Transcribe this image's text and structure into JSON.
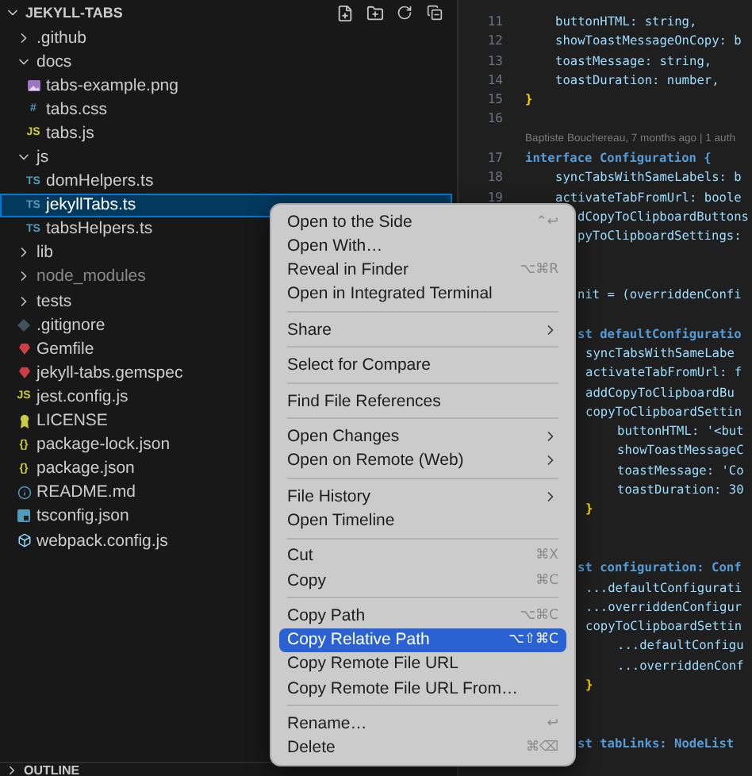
{
  "explorer": {
    "title": "JEKYLL-TABS",
    "expanded": true,
    "tree": [
      {
        "name": ".github",
        "kind": "folder",
        "expanded": false,
        "selected": false,
        "dimmed": false
      },
      {
        "name": "docs",
        "kind": "folder",
        "expanded": true,
        "selected": false,
        "dimmed": false,
        "children": [
          {
            "name": "tabs-example.png",
            "kind": "image",
            "selected": false,
            "dimmed": false
          },
          {
            "name": "tabs.css",
            "kind": "css",
            "glyph": "#",
            "selected": false,
            "dimmed": false
          },
          {
            "name": "tabs.js",
            "kind": "js",
            "glyph": "JS",
            "selected": false,
            "dimmed": false
          }
        ]
      },
      {
        "name": "js",
        "kind": "folder",
        "expanded": true,
        "selected": false,
        "dimmed": false,
        "children": [
          {
            "name": "domHelpers.ts",
            "kind": "ts",
            "glyph": "TS",
            "selected": false,
            "dimmed": false
          },
          {
            "name": "jekyllTabs.ts",
            "kind": "ts",
            "glyph": "TS",
            "selected": true,
            "dimmed": false
          },
          {
            "name": "tabsHelpers.ts",
            "kind": "ts",
            "glyph": "TS",
            "selected": false,
            "dimmed": false
          }
        ]
      },
      {
        "name": "lib",
        "kind": "folder",
        "expanded": false,
        "selected": false,
        "dimmed": false
      },
      {
        "name": "node_modules",
        "kind": "folder",
        "expanded": false,
        "selected": false,
        "dimmed": true
      },
      {
        "name": "tests",
        "kind": "folder",
        "expanded": false,
        "selected": false,
        "dimmed": false
      },
      {
        "name": ".gitignore",
        "kind": "ignore",
        "selected": false,
        "dimmed": false
      },
      {
        "name": "Gemfile",
        "kind": "gem",
        "selected": false,
        "dimmed": false
      },
      {
        "name": "jekyll-tabs.gemspec",
        "kind": "gem",
        "selected": false,
        "dimmed": false
      },
      {
        "name": "jest.config.js",
        "kind": "js",
        "glyph": "JS",
        "selected": false,
        "dimmed": false
      },
      {
        "name": "LICENSE",
        "kind": "license",
        "selected": false,
        "dimmed": false
      },
      {
        "name": "package-lock.json",
        "kind": "json",
        "glyph": "{}",
        "selected": false,
        "dimmed": false
      },
      {
        "name": "package.json",
        "kind": "json",
        "glyph": "{}",
        "selected": false,
        "dimmed": false
      },
      {
        "name": "README.md",
        "kind": "info",
        "selected": false,
        "dimmed": false
      },
      {
        "name": "tsconfig.json",
        "kind": "tsconfig",
        "selected": false,
        "dimmed": false
      },
      {
        "name": "webpack.config.js",
        "kind": "webpack",
        "selected": false,
        "dimmed": false
      }
    ]
  },
  "outline": {
    "title": "OUTLINE",
    "expanded": false
  },
  "editor": {
    "lines": [
      {
        "kind": "blank"
      },
      {
        "kind": "indent1",
        "number": "11",
        "text": "buttonHTML: string,"
      },
      {
        "kind": "indent1",
        "number": "12",
        "text": "showToastMessageOnCopy: b"
      },
      {
        "kind": "indent1",
        "number": "13",
        "text": "toastMessage: string,"
      },
      {
        "kind": "indent1",
        "number": "14",
        "text": "toastDuration: number,"
      },
      {
        "kind": "flush",
        "number": "15",
        "text": "}",
        "color": "#ffd700"
      },
      {
        "kind": "blank",
        "number": "16"
      },
      {
        "kind": "blame",
        "text": "Baptiste Bouchereau, 7 months ago | 1 auth"
      },
      {
        "kind": "flush",
        "number": "17",
        "text": "interface Configuration {",
        "color": "#569cd6"
      },
      {
        "kind": "indent1",
        "number": "18",
        "text": "syncTabsWithSameLabels: b"
      },
      {
        "kind": "indent1",
        "number": "19",
        "text": "activateTabFromUrl: boole"
      },
      {
        "kind": "clipped",
        "text": "dCopyToClipboardButtons"
      },
      {
        "kind": "clipped",
        "text": "pyToClipboardSettings:"
      },
      {
        "kind": "blank"
      },
      {
        "kind": "blank"
      },
      {
        "kind": "clipped",
        "text": "nit = (overriddenConfi"
      },
      {
        "kind": "blank"
      },
      {
        "kind": "clipped",
        "text": "st defaultConfiguratio",
        "color": "#569cd6"
      },
      {
        "kind": "indent2",
        "text": "syncTabsWithSameLabe"
      },
      {
        "kind": "indent2",
        "text": "activateTabFromUrl: f"
      },
      {
        "kind": "indent2",
        "text": "addCopyToClipboardBu"
      },
      {
        "kind": "indent2",
        "text": "copyToClipboardSettin"
      },
      {
        "kind": "indent3",
        "text": "buttonHTML: '<but"
      },
      {
        "kind": "indent3",
        "text": "showToastMessageC"
      },
      {
        "kind": "indent3",
        "text": "toastMessage: 'Co"
      },
      {
        "kind": "indent3",
        "text": "toastDuration: 30"
      },
      {
        "kind": "indent2",
        "text": "}",
        "color": "#ffd700"
      },
      {
        "kind": "blank"
      },
      {
        "kind": "blank"
      },
      {
        "kind": "clipped",
        "text": "st configuration: Conf",
        "color": "#569cd6"
      },
      {
        "kind": "indent2",
        "text": "...defaultConfigurati"
      },
      {
        "kind": "indent2",
        "text": "...overriddenConfigur"
      },
      {
        "kind": "indent2",
        "text": "copyToClipboardSettin"
      },
      {
        "kind": "indent3",
        "text": "...defaultConfigu"
      },
      {
        "kind": "indent3",
        "text": "...overriddenConf"
      },
      {
        "kind": "indent2",
        "text": "}",
        "color": "#ffd700"
      },
      {
        "kind": "blank"
      },
      {
        "kind": "blank"
      },
      {
        "kind": "clipped",
        "text": "st tabLinks: NodeList",
        "color": "#569cd6"
      }
    ]
  },
  "context_menu": {
    "groups": [
      [
        {
          "label": "Open to the Side",
          "shortcut": "⌃↩",
          "submenu": false,
          "selected": false
        },
        {
          "label": "Open With…",
          "submenu": false,
          "selected": false
        },
        {
          "label": "Reveal in Finder",
          "shortcut": "⌥⌘R",
          "submenu": false,
          "selected": false
        },
        {
          "label": "Open in Integrated Terminal",
          "submenu": false,
          "selected": false
        }
      ],
      [
        {
          "label": "Share",
          "submenu": true,
          "selected": false
        }
      ],
      [
        {
          "label": "Select for Compare",
          "submenu": false,
          "selected": false
        }
      ],
      [
        {
          "label": "Find File References",
          "submenu": false,
          "selected": false
        }
      ],
      [
        {
          "label": "Open Changes",
          "submenu": true,
          "selected": false
        },
        {
          "label": "Open on Remote (Web)",
          "submenu": true,
          "selected": false
        }
      ],
      [
        {
          "label": "File History",
          "submenu": true,
          "selected": false
        },
        {
          "label": "Open Timeline",
          "submenu": false,
          "selected": false
        }
      ],
      [
        {
          "label": "Cut",
          "shortcut": "⌘X",
          "submenu": false,
          "selected": false
        },
        {
          "label": "Copy",
          "shortcut": "⌘C",
          "submenu": false,
          "selected": false
        }
      ],
      [
        {
          "label": "Copy Path",
          "shortcut": "⌥⌘C",
          "submenu": false,
          "selected": false
        },
        {
          "label": "Copy Relative Path",
          "shortcut": "⌥⇧⌘C",
          "submenu": false,
          "selected": true
        },
        {
          "label": "Copy Remote File URL",
          "submenu": false,
          "selected": false
        },
        {
          "label": "Copy Remote File URL From…",
          "submenu": false,
          "selected": false
        }
      ],
      [
        {
          "label": "Rename…",
          "shortcut": "↩",
          "submenu": false,
          "selected": false
        },
        {
          "label": "Delete",
          "shortcut": "⌘⌫",
          "submenu": false,
          "selected": false
        }
      ]
    ]
  }
}
